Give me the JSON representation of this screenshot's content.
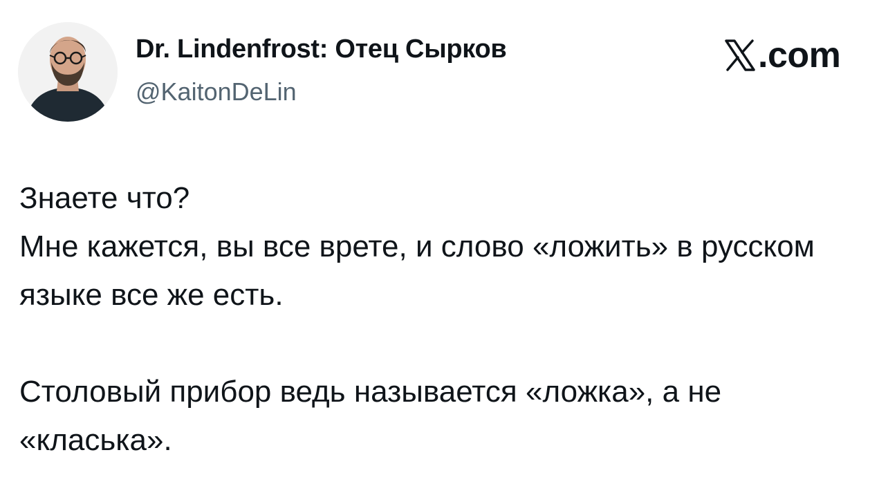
{
  "author": {
    "name": "Dr. Lindenfrost: Отец Сырков",
    "handle": "@KaitonDeLin"
  },
  "brand": {
    "logo_icon": "x-logo-icon",
    "text": ".com"
  },
  "tweet": {
    "paragraph_1": "Знаете что?\nМне кажется, вы все врете, и слово «ложить» в русском языке все же есть.",
    "paragraph_2": "Столовый прибор ведь называется «ложка», а не «класька»."
  },
  "colors": {
    "text_primary": "#0f1419",
    "text_secondary": "#536471",
    "background": "#ffffff"
  }
}
